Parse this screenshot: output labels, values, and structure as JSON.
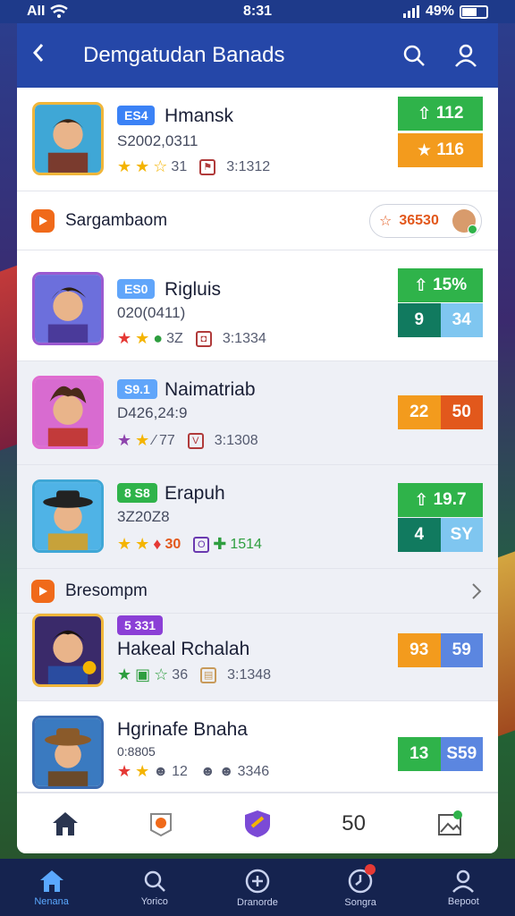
{
  "status_bar": {
    "time": "8:31",
    "battery": "49%",
    "signal_label": "AII"
  },
  "header": {
    "title": "Demgatudan Banads"
  },
  "rows": [
    {
      "badge": "ES4",
      "badge_color": "#3b82f6",
      "name": "Hmansk",
      "sub": "S2002,0311",
      "rating": "31",
      "count": "3:1312",
      "score_top": "112",
      "score_bottom": "116"
    },
    {
      "badge": "ES0",
      "badge_color": "#60a5fa",
      "name": "Rigluis",
      "sub": "020(0411)",
      "rating": "3Z",
      "count": "3:1334",
      "score_top": "15%",
      "score_left": "9",
      "score_right": "34"
    },
    {
      "badge": "S9.1",
      "badge_color": "#60a5fa",
      "name": "Naimatriab",
      "sub": "D426,24:9",
      "rating": "77",
      "count": "3:1308",
      "score_left": "22",
      "score_right": "50"
    },
    {
      "badge": "8 S8",
      "badge_color": "#2fb34a",
      "name": "Erapuh",
      "sub": "3Z20Z8",
      "rating": "30",
      "count": "1514",
      "score_top": "19.7",
      "score_left": "4",
      "score_right": "SY"
    },
    {
      "badge": "5 331",
      "badge_color": "#8b3fd6",
      "name": "Hakeal Rchalah",
      "rating": "36",
      "count": "3:1348",
      "score_left": "93",
      "score_right": "59"
    },
    {
      "name": "Hgrinafe Bnaha",
      "sub": "0:8805",
      "rating": "12",
      "count": "3346",
      "score_left": "13",
      "score_right": "S59"
    }
  ],
  "sections": [
    {
      "label": "Sargambaom",
      "chip_value": "36530"
    },
    {
      "label": "Bresompm"
    }
  ],
  "bottom_nav": [
    {
      "label": "Nenana",
      "icon": "home-icon"
    },
    {
      "label": "Yorico",
      "icon": "search-icon"
    },
    {
      "label": "Dranorde",
      "icon": "plus-circle-icon"
    },
    {
      "label": "Songra",
      "icon": "clock-icon"
    },
    {
      "label": "Bepoot",
      "icon": "user-icon"
    }
  ],
  "panel_nav": {
    "count_label": "50"
  }
}
